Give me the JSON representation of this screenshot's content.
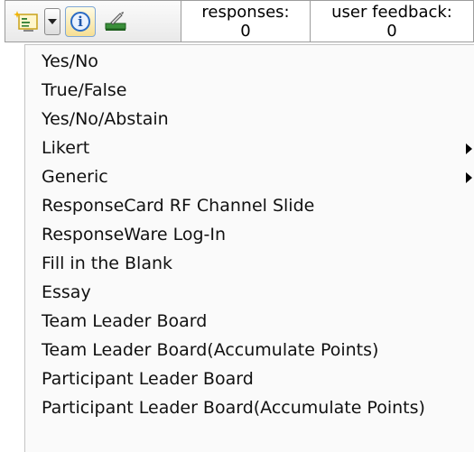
{
  "toolbar": {
    "info_glyph": "i",
    "counters": {
      "responses_label": "responses:",
      "responses_value": "0",
      "feedback_label": "user feedback:",
      "feedback_value": "0"
    }
  },
  "menu": {
    "items": [
      {
        "label": "Yes/No",
        "has_submenu": false
      },
      {
        "label": "True/False",
        "has_submenu": false
      },
      {
        "label": "Yes/No/Abstain",
        "has_submenu": false
      },
      {
        "label": "Likert",
        "has_submenu": true
      },
      {
        "label": "Generic",
        "has_submenu": true
      },
      {
        "label": "ResponseCard RF Channel Slide",
        "has_submenu": false
      },
      {
        "label": "ResponseWare Log-In",
        "has_submenu": false
      },
      {
        "label": "Fill in the Blank",
        "has_submenu": false
      },
      {
        "label": "Essay",
        "has_submenu": false
      },
      {
        "label": "Team Leader Board",
        "has_submenu": false
      },
      {
        "label": "Team Leader Board(Accumulate Points)",
        "has_submenu": false
      },
      {
        "label": "Participant Leader Board",
        "has_submenu": false
      },
      {
        "label": "Participant Leader Board(Accumulate Points)",
        "has_submenu": false
      }
    ]
  },
  "icons": {
    "slide": "insert-slide-icon",
    "dropdown": "dropdown-arrow-icon",
    "info": "info-icon",
    "charge": "device-charge-icon",
    "submenu": "submenu-arrow-icon"
  }
}
